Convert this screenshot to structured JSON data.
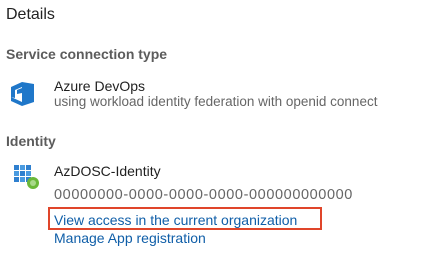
{
  "details": {
    "title": "Details"
  },
  "service_connection": {
    "header": "Service connection type",
    "icon": "azure-devops-icon",
    "name": "Azure DevOps",
    "description": "using workload identity federation with openid connect"
  },
  "identity": {
    "header": "Identity",
    "icon": "identity-grid-icon",
    "name": "AzDOSC-Identity",
    "id": "00000000-0000-0000-0000-000000000000",
    "links": {
      "view_access": "View access in the current organization",
      "manage_app": "Manage App registration"
    }
  },
  "colors": {
    "link": "#0f5ea8",
    "highlight": "#e0452a",
    "devops_blue": "#1f77c9"
  }
}
